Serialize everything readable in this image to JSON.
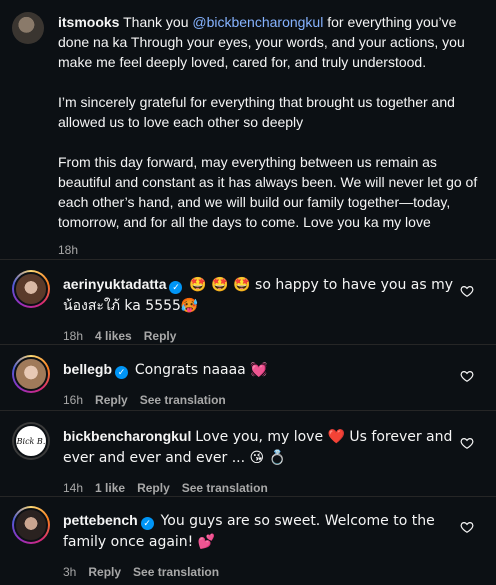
{
  "caption": {
    "username": "itsmooks",
    "text_before_mention": " Thank you ",
    "mention": "@bickbencharongkul",
    "text_after_mention": " for everything you’ve done na ka Through your eyes, your words, and your actions, you make me feel deeply loved, cared for, and truly understood.",
    "para2": "I’m sincerely grateful for everything that brought us together and allowed us to love each other so deeply",
    "para3": "From this day forward, may everything between us remain as beautiful and constant as it has always been. We will never let go of each other’s hand, and we will build our family together—today, tomorrow, and for all the days to come. Love you ka my love",
    "time": "18h"
  },
  "comments": [
    {
      "username": "aerinyuktadatta",
      "verified": true,
      "text": "🤩 🤩 🤩 so happy to have you as my น้องสะใภ้ ka 5555🥵",
      "time": "18h",
      "likes": "4 likes",
      "reply": "Reply"
    },
    {
      "username": "bellegb",
      "verified": true,
      "text": "Congrats naaaa 💓",
      "time": "16h",
      "reply": "Reply",
      "translation": "See translation"
    },
    {
      "username": "bickbencharongkul",
      "verified": false,
      "text": "Love you, my love ❤️ Us forever and ever and ever and ever ... 😘 💍",
      "time": "14h",
      "likes": "1 like",
      "reply": "Reply",
      "translation": "See translation",
      "avatar_text": "Bick B."
    },
    {
      "username": "pettebench",
      "verified": true,
      "text": "You guys are so sweet. Welcome to the family once again! 💕",
      "time": "3h",
      "reply": "Reply",
      "translation": "See translation"
    }
  ],
  "icons": {
    "like": "heart-outline-icon",
    "verified": "verified-badge-icon"
  }
}
